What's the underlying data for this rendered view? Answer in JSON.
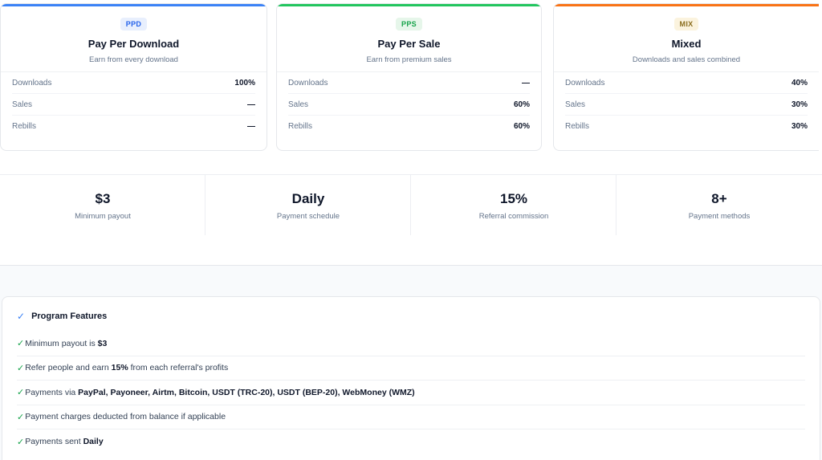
{
  "plans": [
    {
      "badge": "PPD",
      "title": "Pay Per Download",
      "subtitle": "Earn from every download",
      "accent": "#3b82f6",
      "badge_bg": "#e8effd",
      "badge_fg": "#2563eb",
      "rows": [
        {
          "label": "Downloads",
          "value": "100%"
        },
        {
          "label": "Sales",
          "value": "—"
        },
        {
          "label": "Rebills",
          "value": "—"
        }
      ]
    },
    {
      "badge": "PPS",
      "title": "Pay Per Sale",
      "subtitle": "Earn from premium sales",
      "accent": "#22c55e",
      "badge_bg": "#e6f6ea",
      "badge_fg": "#16a34a",
      "rows": [
        {
          "label": "Downloads",
          "value": "—"
        },
        {
          "label": "Sales",
          "value": "60%"
        },
        {
          "label": "Rebills",
          "value": "60%"
        }
      ]
    },
    {
      "badge": "MIX",
      "title": "Mixed",
      "subtitle": "Downloads and sales combined",
      "accent": "#f97316",
      "badge_bg": "#fbf3de",
      "badge_fg": "#8a6d1d",
      "rows": [
        {
          "label": "Downloads",
          "value": "40%"
        },
        {
          "label": "Sales",
          "value": "30%"
        },
        {
          "label": "Rebills",
          "value": "30%"
        }
      ]
    }
  ],
  "stats": [
    {
      "value": "$3",
      "caption": "Minimum payout"
    },
    {
      "value": "Daily",
      "caption": "Payment schedule"
    },
    {
      "value": "15%",
      "caption": "Referral commission"
    },
    {
      "value": "8+",
      "caption": "Payment methods"
    }
  ],
  "features": {
    "title": "Program Features",
    "items": [
      {
        "pre": "Minimum payout is ",
        "bold": "$3",
        "post": ""
      },
      {
        "pre": "Refer people and earn ",
        "bold": "15%",
        "post": " from each referral's profits"
      },
      {
        "pre": "Payments via ",
        "bold": "PayPal, Payoneer, Airtm, Bitcoin, USDT (TRC-20), USDT (BEP-20), WebMoney (WMZ)",
        "post": ""
      },
      {
        "pre": "Payment charges deducted from balance if applicable",
        "bold": "",
        "post": ""
      },
      {
        "pre": "Payments sent ",
        "bold": "Daily",
        "post": ""
      }
    ]
  }
}
